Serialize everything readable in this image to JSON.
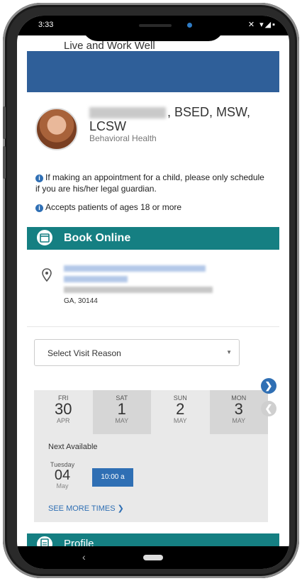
{
  "status": {
    "time": "3:33",
    "icons": "✕ ▾◢▪"
  },
  "header": {
    "top_text": "Live and Work Well"
  },
  "provider": {
    "name_suffix": ", BSED, MSW,",
    "name_line2": "LCSW",
    "specialty": "Behavioral Health"
  },
  "notices": {
    "child": "If making an appointment for a child, please only schedule if you are his/her legal guardian.",
    "ages": "Accepts patients of ages 18 or more"
  },
  "book": {
    "label": "Book Online"
  },
  "location": {
    "city": "GA, 30144"
  },
  "visit_select": {
    "value": "Select Visit Reason"
  },
  "calendar": {
    "days": [
      {
        "dow": "FRI",
        "num": "30",
        "mon": "APR"
      },
      {
        "dow": "SAT",
        "num": "1",
        "mon": "MAY"
      },
      {
        "dow": "SUN",
        "num": "2",
        "mon": "MAY"
      },
      {
        "dow": "MON",
        "num": "3",
        "mon": "MAY"
      }
    ],
    "next_available": "Next Available",
    "next_day": {
      "dow": "Tuesday",
      "num": "04",
      "mon": "May"
    },
    "time_slot": "10:00 a",
    "see_more": "SEE MORE TIMES ❯"
  },
  "profile": {
    "label": "Profile"
  },
  "nav": {
    "back": "‹"
  }
}
